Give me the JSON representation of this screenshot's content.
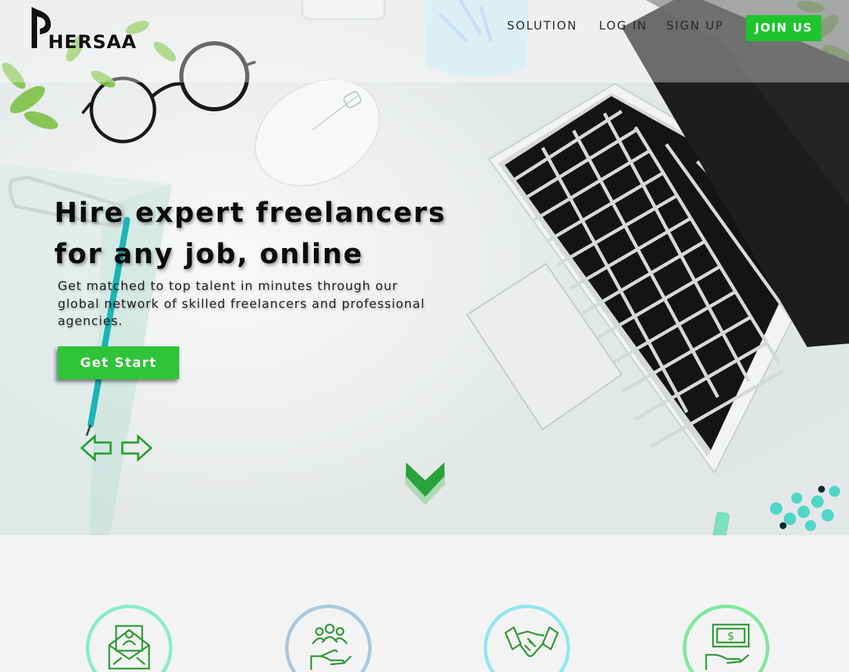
{
  "brand": {
    "name": "HERSAA"
  },
  "nav": {
    "solution": "SOLUTION",
    "login": "LOG IN",
    "signup": "SIGN UP",
    "join": "JOIN US"
  },
  "hero": {
    "headline_line1": "Hire expert freelancers",
    "headline_line2": "for any job, online",
    "subtext": "Get matched to top talent in minutes through our global network of skilled freelancers and professional agencies.",
    "cta": "Get Start"
  },
  "features": [
    {
      "icon": "mail-profile-icon"
    },
    {
      "icon": "team-hand-icon"
    },
    {
      "icon": "handshake-icon"
    },
    {
      "icon": "money-hand-icon"
    }
  ],
  "colors": {
    "accent_green": "#1ec42f",
    "cta_green": "#2fc33a",
    "arrow_green": "#23a02a"
  }
}
